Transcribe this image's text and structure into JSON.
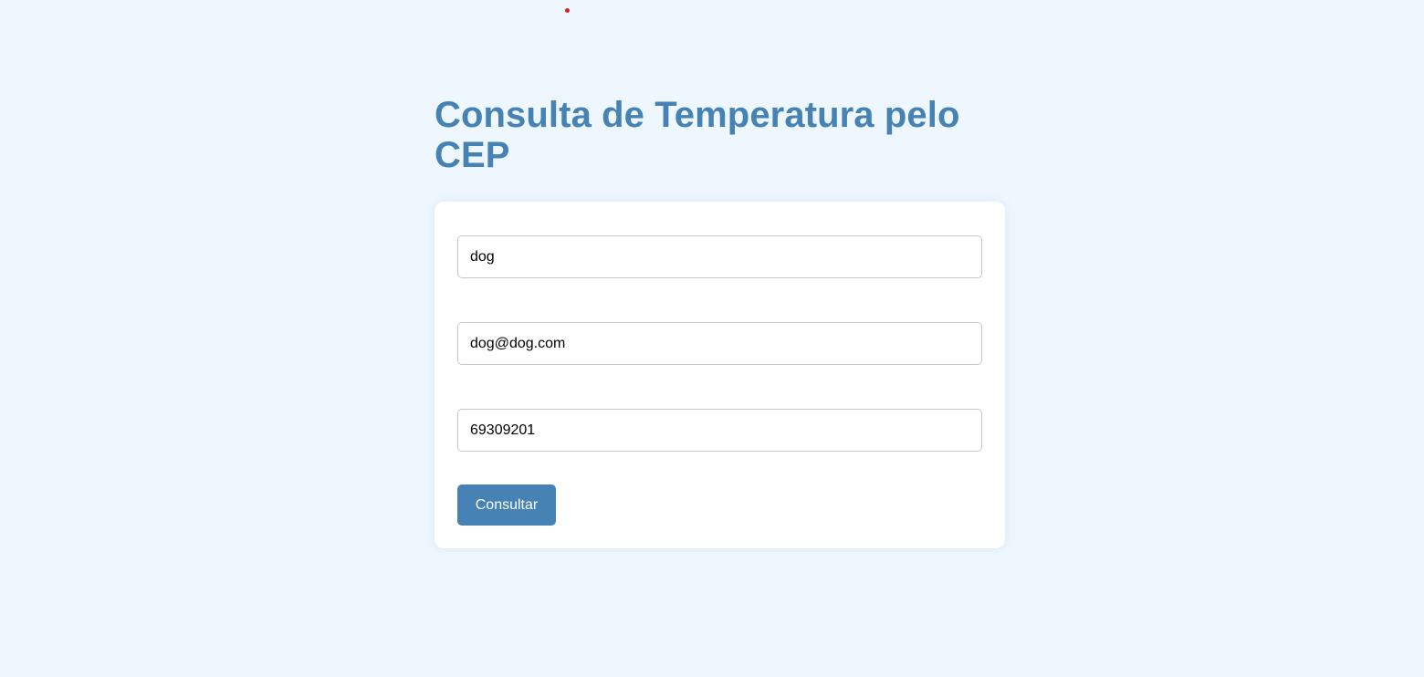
{
  "page": {
    "title": "Consulta de Temperatura pelo CEP"
  },
  "form": {
    "name_value": "dog",
    "email_value": "dog@dog.com",
    "cep_value": "69309201",
    "submit_label": "Consultar"
  },
  "colors": {
    "background": "#eef7fe",
    "accent": "#4682b4",
    "card": "#ffffff",
    "cursor_dot": "#e0201c"
  }
}
